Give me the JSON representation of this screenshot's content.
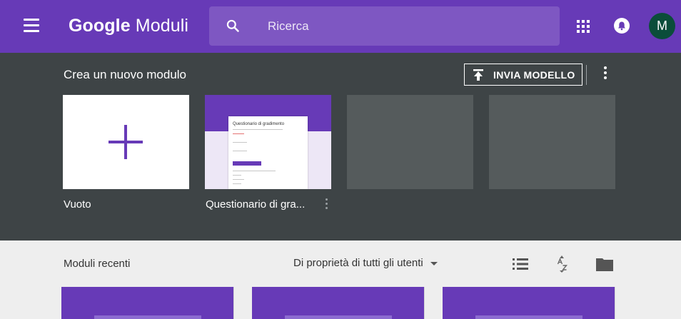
{
  "header": {
    "brand_part1": "Google",
    "brand_part2": "Moduli",
    "search_placeholder": "Ricerca",
    "avatar_initial": "M",
    "icons": [
      "menu-icon",
      "search-icon",
      "apps-icon",
      "notifications-icon"
    ]
  },
  "gallery": {
    "title": "Crea un nuovo modulo",
    "upload_button": "INVIA MODELLO",
    "templates": [
      {
        "label": "Vuoto"
      },
      {
        "label": "Questionario di gra...",
        "preview_title": "Questionario di gradimento"
      }
    ]
  },
  "recent": {
    "title": "Moduli recenti",
    "owner_filter": "Di proprietà di tutti gli utenti",
    "icons": [
      "list-view-icon",
      "sort-az-icon",
      "folder-icon"
    ]
  },
  "colors": {
    "brand": "#673ab7",
    "search_bg": "#7e57c2",
    "gallery_bg": "#3e4446",
    "avatar_bg": "#0b4d3a"
  }
}
